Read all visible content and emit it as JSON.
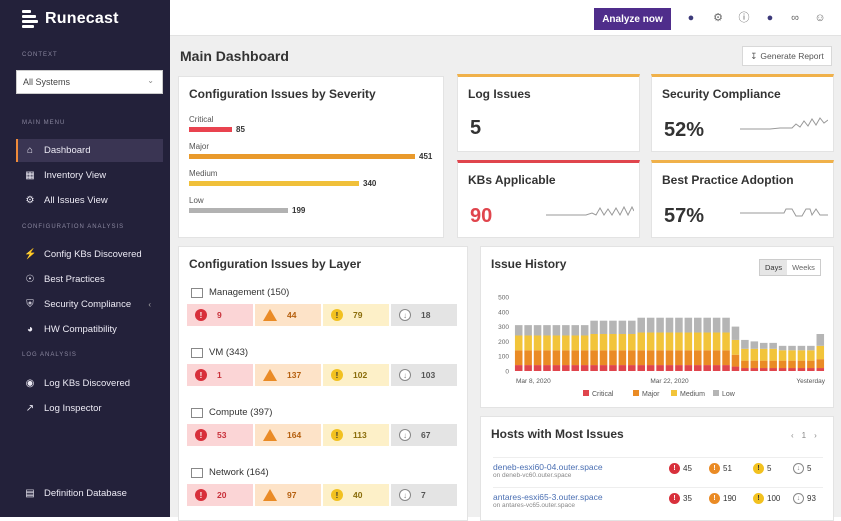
{
  "app": {
    "name": "Runecast"
  },
  "sidebar": {
    "context_label": "CONTEXT",
    "context_value": "All Systems",
    "main_menu_label": "MAIN MENU",
    "config_analysis_label": "CONFIGURATION ANALYSIS",
    "log_analysis_label": "LOG ANALYSIS",
    "items": [
      {
        "label": "Dashboard",
        "icon": "home-icon",
        "active": true
      },
      {
        "label": "Inventory View",
        "icon": "inventory-icon"
      },
      {
        "label": "All Issues View",
        "icon": "bug-icon"
      },
      {
        "label": "Config KBs Discovered",
        "icon": "bolt-icon"
      },
      {
        "label": "Best Practices",
        "icon": "compass-icon"
      },
      {
        "label": "Security Compliance",
        "icon": "shield-icon"
      },
      {
        "label": "HW Compatibility",
        "icon": "gauge-icon"
      },
      {
        "label": "Log KBs Discovered",
        "icon": "eye-icon"
      },
      {
        "label": "Log Inspector",
        "icon": "trend-icon"
      },
      {
        "label": "Definition Database",
        "icon": "database-icon"
      }
    ]
  },
  "topbar": {
    "analyze_label": "Analyze now"
  },
  "main": {
    "title": "Main Dashboard",
    "generate_report_label": "Generate Report",
    "severity_card": {
      "title": "Configuration Issues by Severity",
      "rows": [
        {
          "label": "Critical",
          "value": "85",
          "color": "#e9434f",
          "fraction": 0.19
        },
        {
          "label": "Major",
          "value": "451",
          "color": "#e99a2c",
          "fraction": 1.0
        },
        {
          "label": "Medium",
          "value": "340",
          "color": "#f0c03a",
          "fraction": 0.75
        },
        {
          "label": "Low",
          "value": "199",
          "color": "#b2b2b2",
          "fraction": 0.44
        }
      ]
    },
    "log_issues": {
      "title": "Log Issues",
      "value": "5"
    },
    "security_compliance": {
      "title": "Security Compliance",
      "value": "52%"
    },
    "kbs_applicable": {
      "title": "KBs Applicable",
      "value": "90"
    },
    "best_practice": {
      "title": "Best Practice Adoption",
      "value": "57%"
    },
    "layer_card": {
      "title": "Configuration Issues by Layer",
      "layers": [
        {
          "name": "Management (150)",
          "critical": "9",
          "major": "44",
          "medium": "79",
          "low": "18"
        },
        {
          "name": "VM (343)",
          "critical": "1",
          "major": "137",
          "medium": "102",
          "low": "103"
        },
        {
          "name": "Compute (397)",
          "critical": "53",
          "major": "164",
          "medium": "113",
          "low": "67"
        },
        {
          "name": "Network (164)",
          "critical": "20",
          "major": "97",
          "medium": "40",
          "low": "7"
        }
      ]
    },
    "issue_history": {
      "title": "Issue History",
      "toggle_days": "Days",
      "toggle_weeks": "Weeks"
    },
    "hosts": {
      "title": "Hosts with Most Issues",
      "pager": "1",
      "rows": [
        {
          "host": "deneb-esxi60-04.outer.space",
          "sub": "on deneb-vc60.outer.space",
          "critical": "45",
          "major": "51",
          "medium": "5",
          "low": "5"
        },
        {
          "host": "antares-esxi65-3.outer.space",
          "sub": "on antares-vc65.outer.space",
          "critical": "35",
          "major": "190",
          "medium": "100",
          "low": "93"
        }
      ]
    }
  },
  "chart_data": {
    "type": "bar",
    "title": "Issue History",
    "x_tick_labels": [
      "Mar 8, 2020",
      "Mar 22, 2020",
      "Yesterday"
    ],
    "yticks": [
      0,
      100,
      200,
      300,
      400,
      500
    ],
    "ylim": [
      0,
      500
    ],
    "legend": [
      "Critical",
      "Major",
      "Medium",
      "Low"
    ],
    "legend_placement": "bottom",
    "colors": {
      "Critical": "#e0454d",
      "Major": "#ea8b25",
      "Medium": "#f2c43a",
      "Low": "#b5b5b5"
    },
    "series": [
      {
        "name": "Critical",
        "values": [
          40,
          40,
          40,
          40,
          40,
          40,
          40,
          40,
          40,
          40,
          40,
          40,
          40,
          40,
          40,
          40,
          40,
          40,
          40,
          40,
          40,
          40,
          40,
          30,
          20,
          20,
          20,
          20,
          20,
          20,
          20,
          20,
          20
        ]
      },
      {
        "name": "Major",
        "values": [
          100,
          100,
          100,
          100,
          100,
          100,
          100,
          100,
          100,
          100,
          100,
          100,
          100,
          100,
          100,
          100,
          100,
          100,
          100,
          100,
          100,
          100,
          100,
          80,
          50,
          50,
          50,
          50,
          50,
          50,
          50,
          50,
          60
        ]
      },
      {
        "name": "Medium",
        "values": [
          100,
          100,
          100,
          100,
          100,
          100,
          100,
          100,
          110,
          110,
          110,
          110,
          110,
          120,
          120,
          120,
          120,
          120,
          120,
          120,
          120,
          120,
          120,
          100,
          80,
          80,
          80,
          80,
          70,
          70,
          70,
          70,
          90
        ]
      },
      {
        "name": "Low",
        "values": [
          70,
          70,
          70,
          70,
          70,
          70,
          70,
          70,
          90,
          90,
          90,
          90,
          90,
          100,
          100,
          100,
          100,
          100,
          100,
          100,
          100,
          100,
          100,
          90,
          60,
          50,
          40,
          40,
          30,
          30,
          30,
          30,
          80
        ]
      }
    ]
  }
}
